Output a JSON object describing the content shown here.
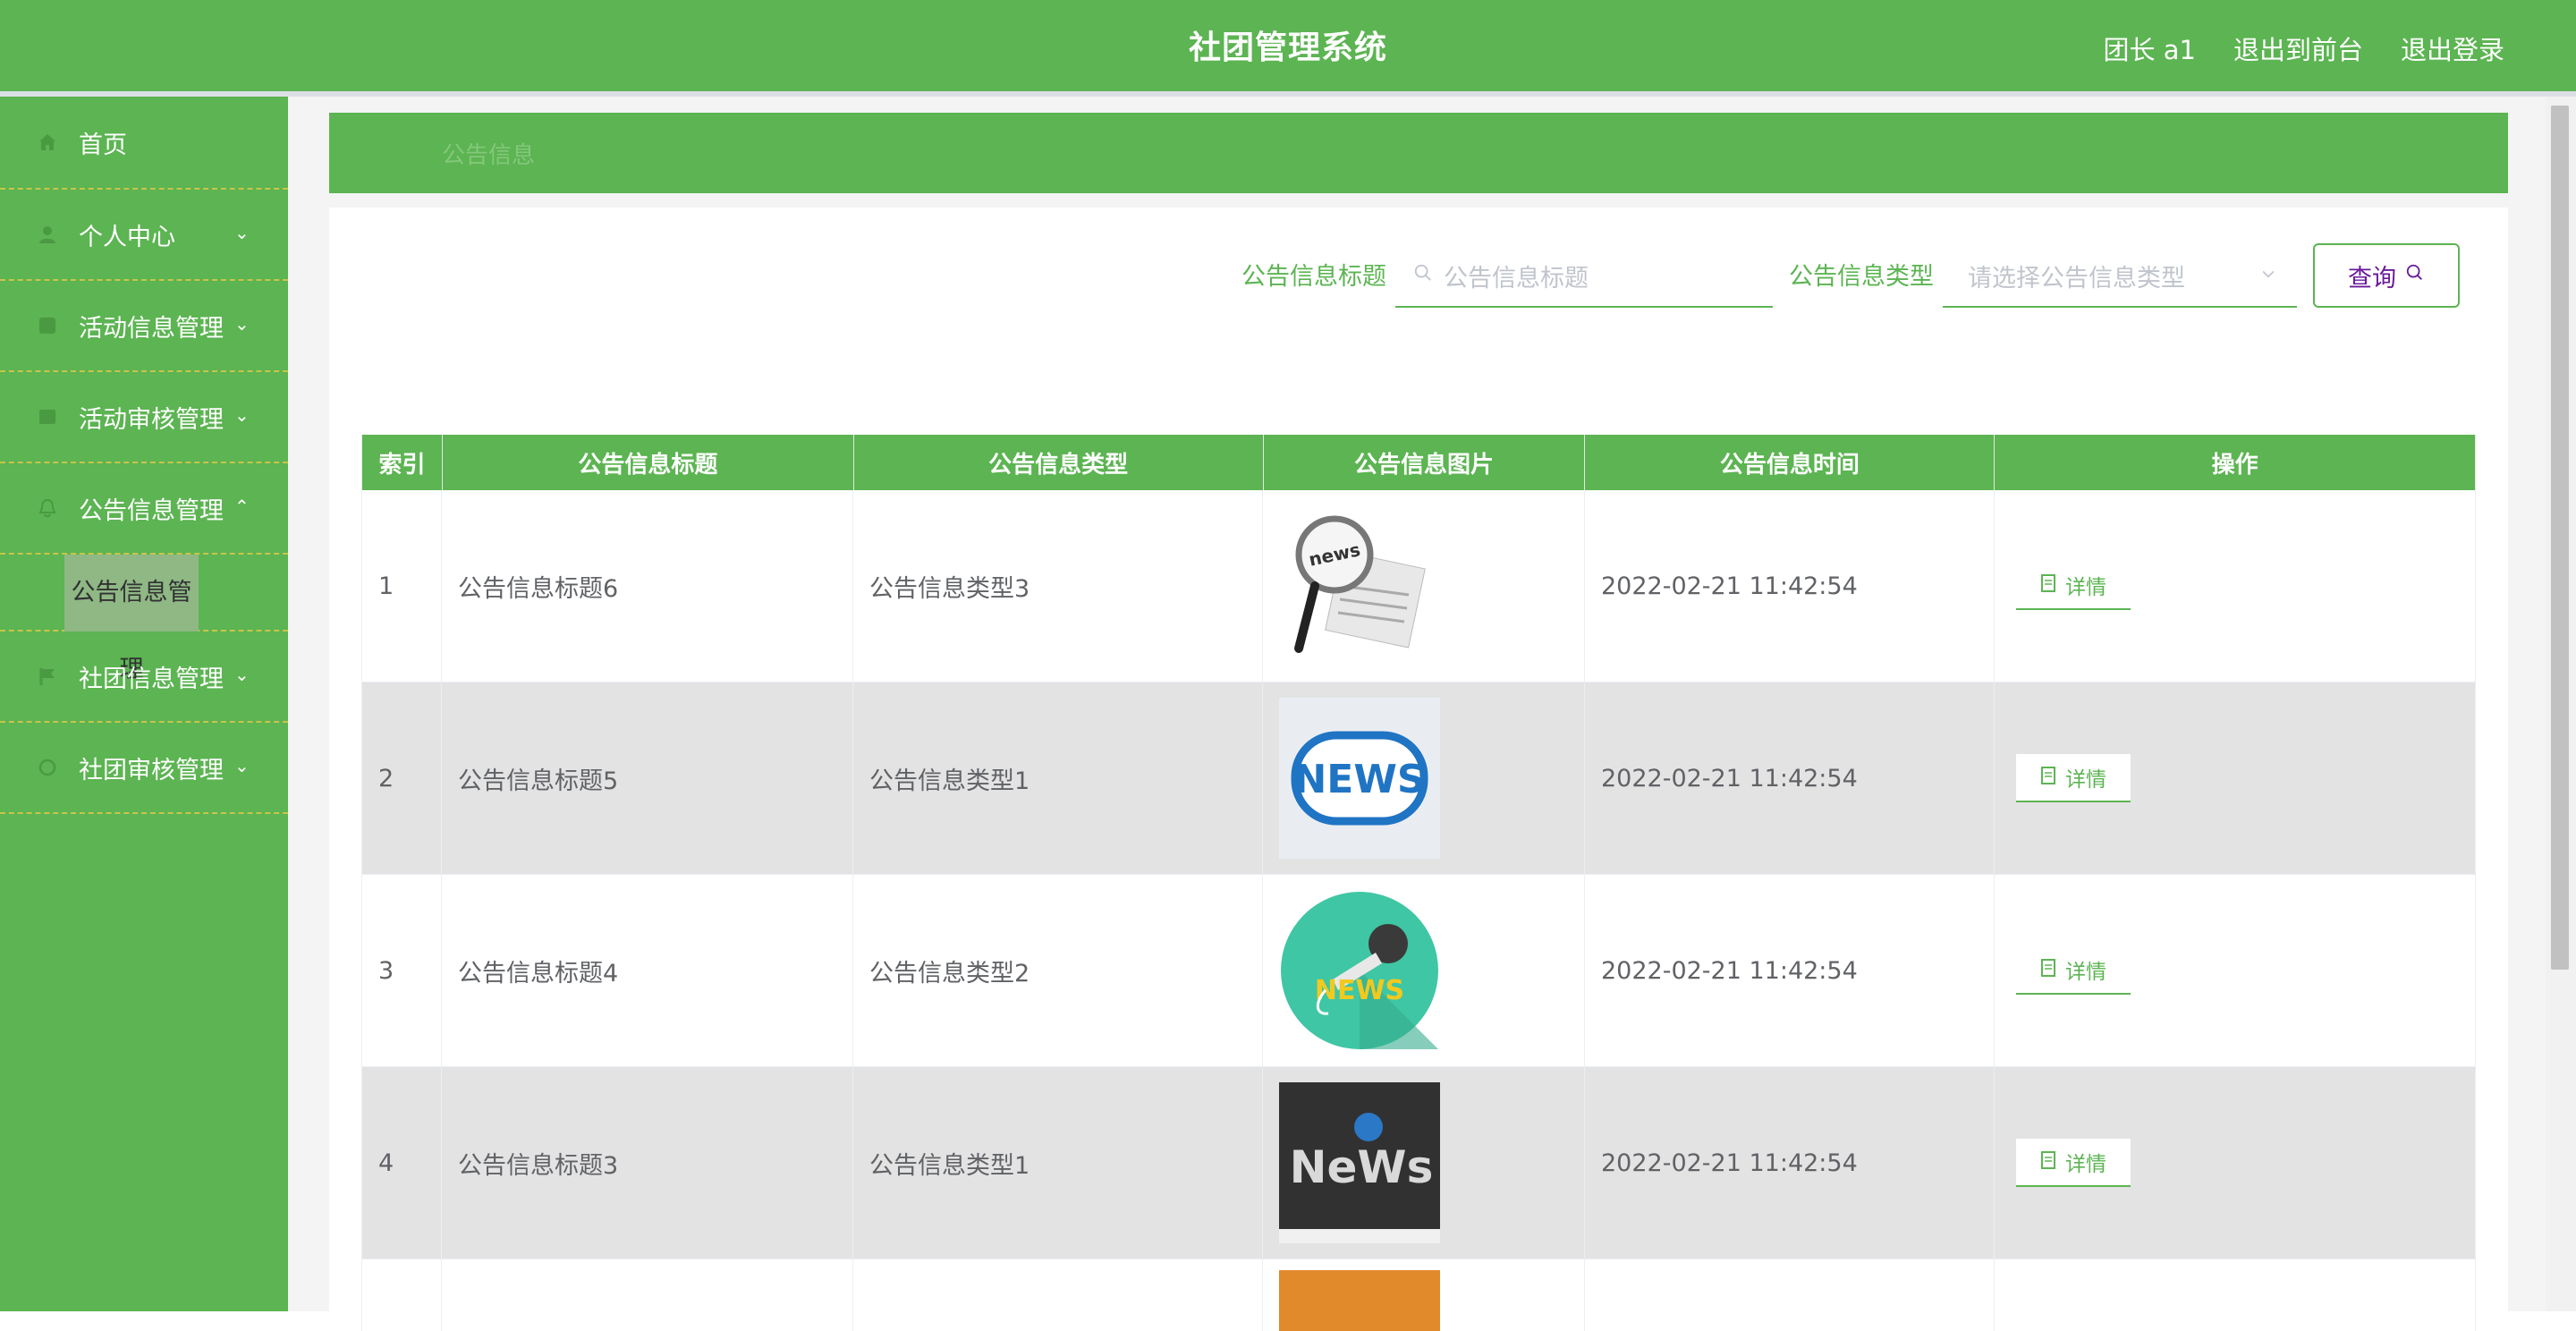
{
  "header": {
    "title": "社团管理系统",
    "user": "团长 a1",
    "to_front": "退出到前台",
    "logout": "退出登录"
  },
  "sidebar": {
    "items": [
      {
        "label": "首页",
        "icon": "home-icon"
      },
      {
        "label": "个人中心",
        "icon": "user-icon"
      },
      {
        "label": "活动信息管理",
        "icon": "activity-icon"
      },
      {
        "label": "活动审核管理",
        "icon": "review-icon"
      },
      {
        "label": "公告信息管理",
        "icon": "notice-icon"
      },
      {
        "label": "社团信息管理",
        "icon": "flag-icon"
      },
      {
        "label": "社团审核管理",
        "icon": "audit-icon"
      }
    ],
    "sub_active": "公告信息管理"
  },
  "breadcrumb": "公告信息",
  "search": {
    "title_label": "公告信息标题",
    "title_placeholder": "公告信息标题",
    "type_label": "公告信息类型",
    "type_placeholder": "请选择公告信息类型",
    "query_label": "查询"
  },
  "table": {
    "columns": [
      "索引",
      "公告信息标题",
      "公告信息类型",
      "公告信息图片",
      "公告信息时间",
      "操作"
    ],
    "rows": [
      {
        "index": "1",
        "title": "公告信息标题6",
        "type": "公告信息类型3",
        "time": "2022-02-21 11:42:54",
        "action": "详情"
      },
      {
        "index": "2",
        "title": "公告信息标题5",
        "type": "公告信息类型1",
        "time": "2022-02-21 11:42:54",
        "action": "详情"
      },
      {
        "index": "3",
        "title": "公告信息标题4",
        "type": "公告信息类型2",
        "time": "2022-02-21 11:42:54",
        "action": "详情"
      },
      {
        "index": "4",
        "title": "公告信息标题3",
        "type": "公告信息类型1",
        "time": "2022-02-21 11:42:54",
        "action": "详情"
      }
    ],
    "image_text": {
      "r1": "news",
      "r2": "NEWS",
      "r3": "NEWS",
      "r4": "NeWs"
    }
  },
  "colors": {
    "primary": "#5cb452",
    "row_alt": "#e3e3e3",
    "query_text": "#6a1b9a"
  }
}
